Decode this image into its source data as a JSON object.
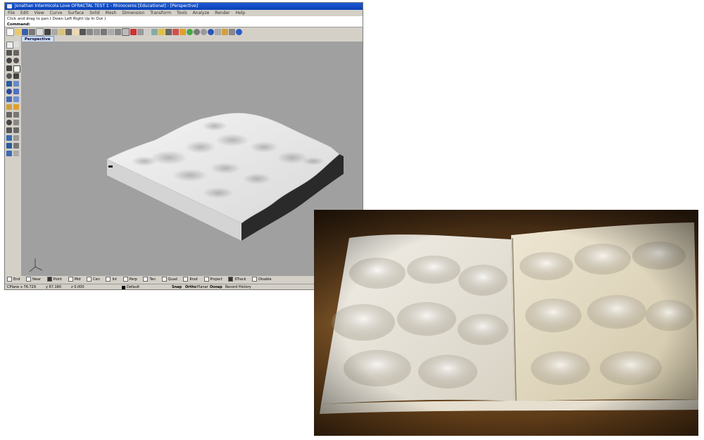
{
  "window": {
    "title": "Jonathan Intermicola Love OFRACTAL TEST 1 - Rhinoceros [Educational] - [Perspective]"
  },
  "menu": [
    "File",
    "Edit",
    "View",
    "Curve",
    "Surface",
    "Solid",
    "Mesh",
    "Dimension",
    "Transform",
    "Tools",
    "Analyze",
    "Render",
    "Help"
  ],
  "command_history": "Click and drag to pan ( Down Left Right Up In Out )",
  "command_prompt": "Command:",
  "viewport": {
    "tab_label": "Perspective",
    "background": "#a0a0a0"
  },
  "osnap": {
    "items": [
      {
        "label": "End",
        "checked": false
      },
      {
        "label": "Near",
        "checked": false
      },
      {
        "label": "Point",
        "checked": true
      },
      {
        "label": "Mid",
        "checked": false
      },
      {
        "label": "Cen",
        "checked": false
      },
      {
        "label": "Int",
        "checked": false
      },
      {
        "label": "Perp",
        "checked": false
      },
      {
        "label": "Tan",
        "checked": false
      },
      {
        "label": "Quad",
        "checked": false
      },
      {
        "label": "Knot",
        "checked": false
      },
      {
        "label": "Project",
        "checked": false
      },
      {
        "label": "STrack",
        "checked": true
      },
      {
        "label": "Disable",
        "checked": false
      }
    ]
  },
  "status": {
    "cplane": "CPlane",
    "x": "x 76.729",
    "y": "y 67.180",
    "z": "z 0.000",
    "layer": "Default",
    "snap": "Snap",
    "ortho": "Ortho",
    "planar": "Planar",
    "osnap": "Osnap",
    "record_history": "Record History"
  },
  "colors": {
    "titlebar": "#0a3fb4",
    "chrome": "#d4d0c8",
    "viewport": "#a0a0a0",
    "wood": "#6e4a22"
  }
}
